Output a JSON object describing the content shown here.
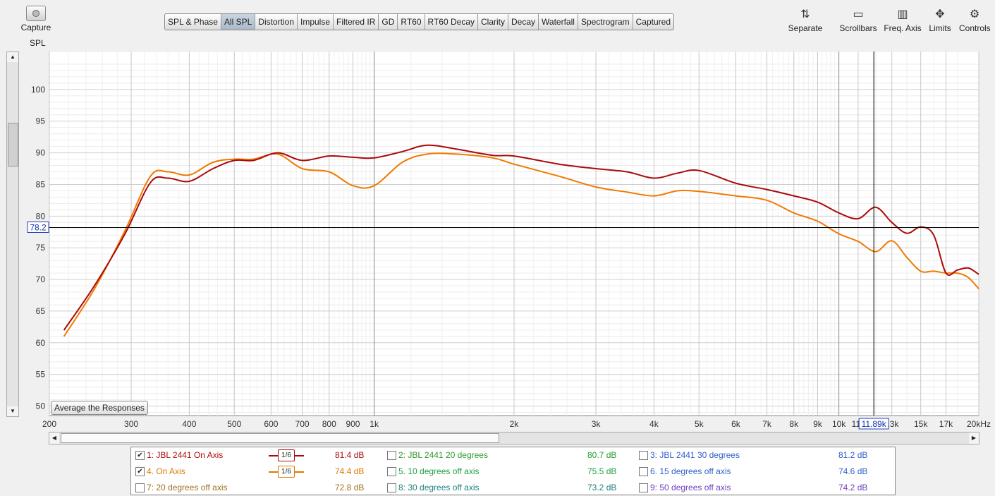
{
  "capture": {
    "label": "Capture",
    "sub": "SPL",
    "icon": "camera-icon"
  },
  "tabs": [
    "SPL & Phase",
    "All SPL",
    "Distortion",
    "Impulse",
    "Filtered IR",
    "GD",
    "RT60",
    "RT60 Decay",
    "Clarity",
    "Decay",
    "Waterfall",
    "Spectrogram",
    "Captured"
  ],
  "active_tab": "All SPL",
  "tools": [
    {
      "label": "Separate",
      "icon": "separate-traces-icon"
    },
    {
      "label": "Scrollbars",
      "icon": "scrollbars-icon"
    },
    {
      "label": "Freq. Axis",
      "icon": "freq-axis-icon"
    },
    {
      "label": "Limits",
      "icon": "limits-icon"
    },
    {
      "label": "Controls",
      "icon": "gear-icon"
    }
  ],
  "average_button": "Average the Responses",
  "cursor": {
    "y_readout": "78.2",
    "x_readout": "11.89k",
    "y_value": 78.2,
    "x_value": 11890
  },
  "chart_data": {
    "type": "line",
    "xscale": "log",
    "xlim": [
      200,
      20000
    ],
    "ylim": [
      48.5,
      106
    ],
    "ylabel": "",
    "xlabel": "",
    "yticks": [
      50,
      55,
      60,
      65,
      70,
      75,
      80,
      85,
      90,
      95,
      100
    ],
    "xticks": [
      {
        "v": 200,
        "l": "200"
      },
      {
        "v": 300,
        "l": "300"
      },
      {
        "v": 400,
        "l": "400"
      },
      {
        "v": 500,
        "l": "500"
      },
      {
        "v": 600,
        "l": "600"
      },
      {
        "v": 700,
        "l": "700"
      },
      {
        "v": 800,
        "l": "800"
      },
      {
        "v": 900,
        "l": "900"
      },
      {
        "v": 1000,
        "l": "1k"
      },
      {
        "v": 2000,
        "l": "2k"
      },
      {
        "v": 3000,
        "l": "3k"
      },
      {
        "v": 4000,
        "l": "4k"
      },
      {
        "v": 5000,
        "l": "5k"
      },
      {
        "v": 6000,
        "l": "6k"
      },
      {
        "v": 7000,
        "l": "7k"
      },
      {
        "v": 8000,
        "l": "8k"
      },
      {
        "v": 9000,
        "l": "9k"
      },
      {
        "v": 10000,
        "l": "10k"
      },
      {
        "v": 11000,
        "l": "11k"
      },
      {
        "v": 13000,
        "l": "13k"
      },
      {
        "v": 15000,
        "l": "15k"
      },
      {
        "v": 17000,
        "l": "17k"
      },
      {
        "v": 20000,
        "l": "20kHz"
      }
    ],
    "series": [
      {
        "name": "1: JBL 2441 On Axis",
        "color": "#aa0a0a",
        "x": [
          215,
          250,
          290,
          330,
          360,
          400,
          450,
          500,
          550,
          620,
          700,
          800,
          900,
          1000,
          1150,
          1300,
          1500,
          1800,
          2000,
          2500,
          3000,
          3500,
          4000,
          4500,
          5000,
          6000,
          7000,
          8000,
          9000,
          10000,
          11000,
          12000,
          13000,
          14000,
          15000,
          16000,
          17000,
          18000,
          19000,
          20000
        ],
        "y": [
          62,
          69,
          77,
          85.3,
          86,
          85.5,
          87.5,
          88.8,
          88.8,
          90,
          88.8,
          89.5,
          89.3,
          89.2,
          90.2,
          91.2,
          90.6,
          89.6,
          89.5,
          88.2,
          87.5,
          87,
          86,
          86.8,
          87.2,
          85.2,
          84.2,
          83.2,
          82.2,
          80.5,
          79.6,
          81.4,
          79,
          77.3,
          78.3,
          77,
          71,
          71.5,
          71.8,
          70.8
        ]
      },
      {
        "name": "4. On Axis",
        "color": "#f07a00",
        "x": [
          215,
          250,
          290,
          330,
          360,
          400,
          450,
          500,
          550,
          620,
          700,
          800,
          900,
          1000,
          1150,
          1300,
          1500,
          1800,
          2000,
          2500,
          3000,
          3500,
          4000,
          4500,
          5000,
          6000,
          7000,
          8000,
          9000,
          10000,
          11000,
          12000,
          13000,
          14000,
          15000,
          16000,
          17000,
          18000,
          19000,
          20000
        ],
        "y": [
          61,
          68.5,
          77.5,
          86.3,
          87,
          86.5,
          88.5,
          89,
          89,
          89.8,
          87.5,
          87,
          84.8,
          84.8,
          88.5,
          89.8,
          89.8,
          89.2,
          88.2,
          86.3,
          84.6,
          83.8,
          83.2,
          84,
          83.9,
          83.2,
          82.5,
          80.5,
          79.2,
          77.2,
          76,
          74.4,
          76.1,
          73.5,
          71.3,
          71.3,
          71,
          71,
          70.3,
          68.5
        ]
      }
    ]
  },
  "legend": [
    [
      {
        "checked": true,
        "name": "1: JBL 2441 On Axis",
        "value": "81.4 dB",
        "color": "#aa0a0a",
        "smoothing": "1/6"
      },
      {
        "checked": false,
        "name": "2: JBL 2441 20 degrees",
        "value": "80.7 dB",
        "color": "#2a9a2a"
      },
      {
        "checked": false,
        "name": "3: JBL 2441 30 degrees",
        "value": "81.2 dB",
        "color": "#3060c8"
      }
    ],
    [
      {
        "checked": true,
        "name": "4. On Axis",
        "value": "74.4 dB",
        "color": "#e07800",
        "smoothing": "1/6"
      },
      {
        "checked": false,
        "name": "5. 10 degrees off axis",
        "value": "75.5 dB",
        "color": "#20a040"
      },
      {
        "checked": false,
        "name": "6. 15 degrees off axis",
        "value": "74.6 dB",
        "color": "#3060c8"
      }
    ],
    [
      {
        "checked": false,
        "name": "7: 20 degrees off axis",
        "value": "72.8 dB",
        "color": "#a07020"
      },
      {
        "checked": false,
        "name": "8: 30 degrees off axis",
        "value": "73.2 dB",
        "color": "#208080"
      },
      {
        "checked": false,
        "name": "9: 50 degrees off axis",
        "value": "74.2 dB",
        "color": "#7040c0"
      }
    ]
  ]
}
